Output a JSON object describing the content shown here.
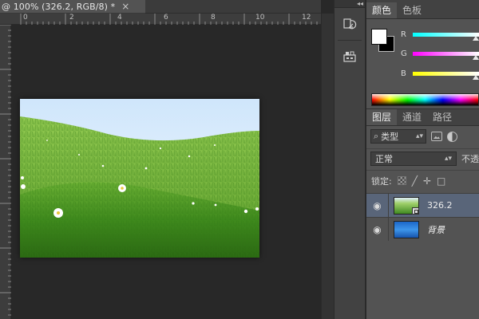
{
  "document": {
    "tab_label": "@ 100% (326.2, RGB/8) *",
    "close_glyph": "×"
  },
  "ruler": {
    "top_ticks": [
      "0",
      "2",
      "4",
      "6",
      "8",
      "10",
      "12"
    ]
  },
  "canvas": {
    "image": "grassy green hill with daisies under pale sky"
  },
  "dock": {
    "collapse_glyph": "◂◂",
    "buttons": [
      "history-icon",
      "properties-icon"
    ]
  },
  "color_panel": {
    "tabs": [
      "颜色",
      "色板"
    ],
    "active_tab": 0,
    "foreground": "#ffffff",
    "background": "#000000",
    "sliders": [
      {
        "label": "R",
        "from": "#00ffff",
        "to": "#ffffff",
        "value": 255
      },
      {
        "label": "G",
        "from": "#ff00ff",
        "to": "#ffffff",
        "value": 255
      },
      {
        "label": "B",
        "from": "#ffff00",
        "to": "#ffffff",
        "value": 255
      }
    ]
  },
  "layers_panel": {
    "tabs": [
      "图层",
      "通道",
      "路径"
    ],
    "active_tab": 0,
    "filter_kind": "类型",
    "blend_mode": "正常",
    "opacity_label": "不透",
    "lock_label": "锁定:",
    "layers": [
      {
        "name": "326.2",
        "type": "smart-object",
        "visible": true,
        "selected": true
      },
      {
        "name": "背景",
        "type": "background",
        "visible": true,
        "selected": false
      }
    ]
  },
  "colors": {
    "panel_bg": "#535353",
    "workspace_bg": "#282828",
    "selected_layer": "#596579"
  }
}
